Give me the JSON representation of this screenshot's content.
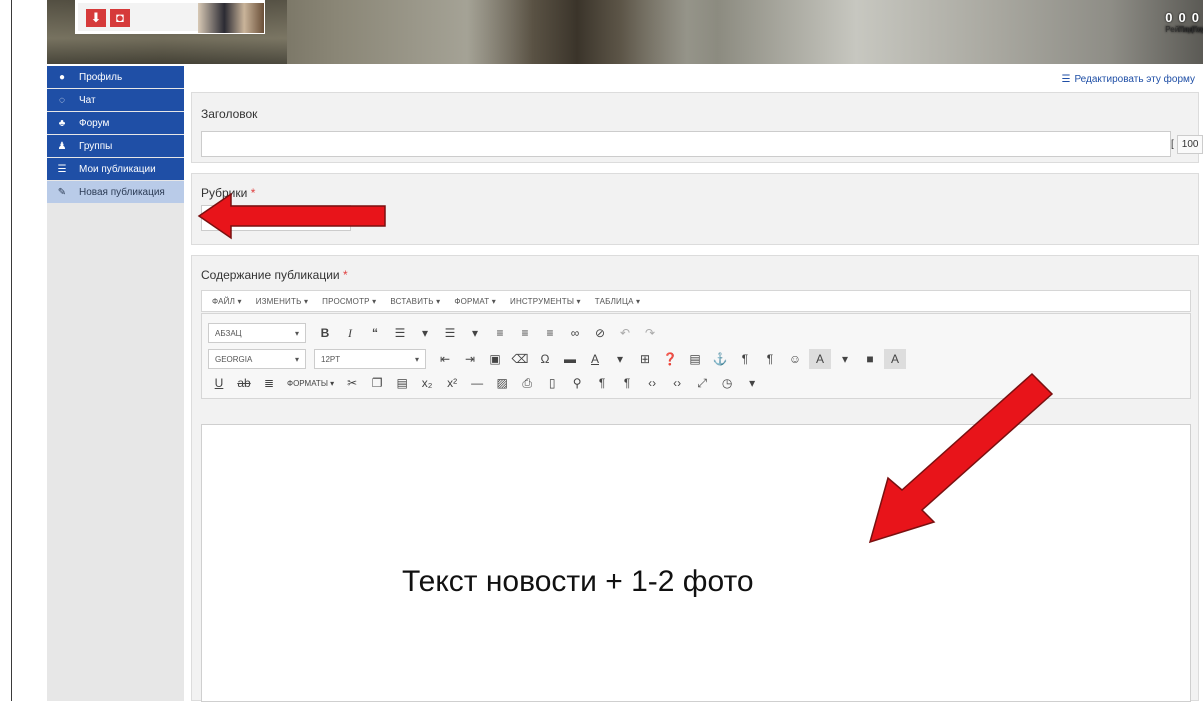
{
  "header": {
    "stats": [
      {
        "value": "0",
        "label": "Рейтинг"
      },
      {
        "value": "0",
        "label": "Подписчики"
      },
      {
        "value": "0",
        "label": "Подписки"
      }
    ]
  },
  "sidebar": {
    "items": [
      {
        "label": "Профиль",
        "icon": "user-icon"
      },
      {
        "label": "Чат",
        "icon": "chat-icon"
      },
      {
        "label": "Форум",
        "icon": "sitemap-icon"
      },
      {
        "label": "Группы",
        "icon": "users-icon"
      },
      {
        "label": "Мои публикации",
        "icon": "list-icon"
      },
      {
        "label": "Новая публикация",
        "icon": "pencil-icon"
      }
    ]
  },
  "main": {
    "edit_form_link": "Редактировать эту форму",
    "title_label": "Заголовок",
    "title_counter": "100",
    "rubrics_label": "Рубрики",
    "required_mark": "*",
    "content_label": "Содержание публикации",
    "menubar": [
      "ФАЙЛ ▾",
      "ИЗМЕНИТЬ ▾",
      "ПРОСМОТР ▾",
      "ВСТАВИТЬ ▾",
      "ФОРМАТ ▾",
      "ИНСТРУМЕНТЫ ▾",
      "ТАБЛИЦА ▾"
    ],
    "toolbar": {
      "paragraph_select": "АБЗАЦ",
      "font_select": "GEORGIA",
      "size_select": "12PT",
      "formats_label": "ФОРМАТЫ ▾"
    }
  },
  "annotation": {
    "text": "Текст новости + 1-2 фото",
    "arrow_color": "#e8141a"
  }
}
